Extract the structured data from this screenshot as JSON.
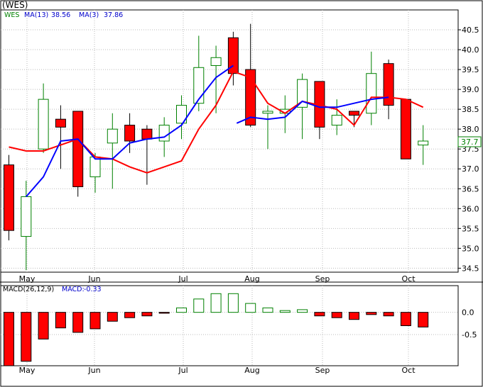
{
  "chart_data": [
    {
      "type": "candlestick",
      "title": "(WES)",
      "legend": [
        {
          "label": "WES",
          "color": "#008000"
        },
        {
          "label": "MA(13)",
          "value_text": "38.56",
          "color": "#0000cc"
        },
        {
          "label": "MA(3)",
          "value_text": "37.86",
          "color": "#0000cc"
        }
      ],
      "last_price_label": "37.7",
      "ylim": [
        34.4,
        41.0
      ],
      "y_ticks": [
        "34.5",
        "35.0",
        "35.5",
        "36.0",
        "36.5",
        "37.0",
        "37.5",
        "38.0",
        "38.5",
        "39.0",
        "39.5",
        "40.0",
        "40.5"
      ],
      "x_ticks": [
        "May",
        "Jun",
        "Jul",
        "Aug",
        "Sep",
        "Oct"
      ],
      "grid": true,
      "colors": {
        "up": "#008000",
        "down": "#ff0000",
        "ma13": "#0000ff",
        "ma3": "#ff0000",
        "up_fill": "#ffffff",
        "down_fill": "#ff0000"
      },
      "candles": [
        {
          "o": 37.1,
          "h": 37.35,
          "l": 35.2,
          "c": 35.45
        },
        {
          "o": 35.3,
          "h": 36.7,
          "l": 34.45,
          "c": 36.3
        },
        {
          "o": 37.5,
          "h": 39.15,
          "l": 37.4,
          "c": 38.75
        },
        {
          "o": 38.25,
          "h": 38.6,
          "l": 37.0,
          "c": 38.05
        },
        {
          "o": 38.45,
          "h": 38.45,
          "l": 36.3,
          "c": 36.55
        },
        {
          "o": 36.8,
          "h": 37.4,
          "l": 36.4,
          "c": 37.3
        },
        {
          "o": 37.65,
          "h": 38.4,
          "l": 36.5,
          "c": 38.0
        },
        {
          "o": 38.1,
          "h": 38.4,
          "l": 37.4,
          "c": 37.7
        },
        {
          "o": 38.0,
          "h": 38.1,
          "l": 36.6,
          "c": 37.75
        },
        {
          "o": 37.7,
          "h": 38.3,
          "l": 37.3,
          "c": 38.1
        },
        {
          "o": 38.15,
          "h": 38.85,
          "l": 37.75,
          "c": 38.6
        },
        {
          "o": 38.65,
          "h": 40.35,
          "l": 38.45,
          "c": 39.55
        },
        {
          "o": 39.6,
          "h": 40.1,
          "l": 38.4,
          "c": 39.8
        },
        {
          "o": 40.3,
          "h": 40.45,
          "l": 39.1,
          "c": 39.4
        },
        {
          "o": 39.5,
          "h": 40.65,
          "l": 38.05,
          "c": 38.1
        },
        {
          "o": 38.4,
          "h": 38.6,
          "l": 37.5,
          "c": 38.45
        },
        {
          "o": 38.4,
          "h": 38.85,
          "l": 37.9,
          "c": 38.5
        },
        {
          "o": 38.55,
          "h": 39.4,
          "l": 37.75,
          "c": 39.25
        },
        {
          "o": 39.2,
          "h": 39.2,
          "l": 37.75,
          "c": 38.05
        },
        {
          "o": 38.1,
          "h": 38.75,
          "l": 37.85,
          "c": 38.35
        },
        {
          "o": 38.45,
          "h": 38.45,
          "l": 38.05,
          "c": 38.35
        },
        {
          "o": 38.4,
          "h": 39.95,
          "l": 38.1,
          "c": 39.4
        },
        {
          "o": 39.65,
          "h": 39.75,
          "l": 38.25,
          "c": 38.6
        },
        {
          "o": 38.75,
          "h": 38.75,
          "l": 37.25,
          "c": 37.25
        },
        {
          "o": 37.6,
          "h": 38.1,
          "l": 37.1,
          "c": 37.7
        }
      ],
      "ma13": [
        {
          "i": 1,
          "v": 36.3
        },
        {
          "i": 2,
          "v": 36.8
        },
        {
          "i": 3,
          "v": 37.7
        },
        {
          "i": 4,
          "v": 37.75
        },
        {
          "i": 5,
          "v": 37.25
        },
        {
          "i": 6,
          "v": 37.25
        },
        {
          "i": 7,
          "v": 37.65
        },
        {
          "i": 8,
          "v": 37.75
        },
        {
          "i": 9,
          "v": 37.8
        },
        {
          "i": 10,
          "v": 38.1
        },
        {
          "i": 11,
          "v": 38.75
        },
        {
          "i": 12,
          "v": 39.3
        },
        {
          "i": 13,
          "v": 39.6
        }
      ],
      "ma13_tail": [
        {
          "i": 13.2,
          "v": 38.15
        },
        {
          "i": 14,
          "v": 38.3
        },
        {
          "i": 15,
          "v": 38.25
        },
        {
          "i": 16,
          "v": 38.3
        },
        {
          "i": 17,
          "v": 38.7
        },
        {
          "i": 18,
          "v": 38.55
        },
        {
          "i": 19,
          "v": 38.55
        },
        {
          "i": 20,
          "v": 38.65
        },
        {
          "i": 21,
          "v": 38.75
        },
        {
          "i": 22,
          "v": 38.8
        }
      ],
      "ma3": [
        {
          "i": 0,
          "v": 37.55
        },
        {
          "i": 1,
          "v": 37.45
        },
        {
          "i": 2,
          "v": 37.45
        },
        {
          "i": 3,
          "v": 37.6
        },
        {
          "i": 4,
          "v": 37.75
        },
        {
          "i": 5,
          "v": 37.3
        },
        {
          "i": 6,
          "v": 37.25
        },
        {
          "i": 7,
          "v": 37.05
        },
        {
          "i": 8,
          "v": 36.9
        },
        {
          "i": 9,
          "v": 37.05
        },
        {
          "i": 10,
          "v": 37.2
        },
        {
          "i": 11,
          "v": 38.0
        },
        {
          "i": 12,
          "v": 38.6
        },
        {
          "i": 13,
          "v": 39.45
        },
        {
          "i": 14,
          "v": 39.3
        },
        {
          "i": 15,
          "v": 38.65
        },
        {
          "i": 16,
          "v": 38.4
        },
        {
          "i": 17,
          "v": 38.7
        },
        {
          "i": 18,
          "v": 38.6
        },
        {
          "i": 19,
          "v": 38.5
        },
        {
          "i": 20,
          "v": 38.1
        },
        {
          "i": 21,
          "v": 38.8
        },
        {
          "i": 22,
          "v": 38.8
        },
        {
          "i": 23,
          "v": 38.75
        },
        {
          "i": 24,
          "v": 38.55
        }
      ]
    },
    {
      "type": "bar",
      "title": "MACD(26,12,9)",
      "legend": [
        {
          "label": "MACD(26,12,9)",
          "color": "#000000"
        },
        {
          "label": "MACD:",
          "value_text": "-0.33",
          "color": "#0000cc"
        }
      ],
      "ylim": [
        -1.2,
        0.6
      ],
      "y_ticks": [
        "0.0",
        "-0.5"
      ],
      "x_ticks": [
        "May",
        "Jun",
        "Jul",
        "Aug",
        "Sep",
        "Oct"
      ],
      "values": [
        -1.2,
        -1.1,
        -0.6,
        -0.35,
        -0.45,
        -0.37,
        -0.2,
        -0.12,
        -0.08,
        -0.02,
        0.1,
        0.3,
        0.42,
        0.42,
        0.2,
        0.1,
        0.04,
        0.06,
        -0.08,
        -0.12,
        -0.16,
        -0.05,
        -0.08,
        -0.3,
        -0.33
      ],
      "colors": {
        "positive": "#008000",
        "negative": "#ff0000"
      }
    }
  ]
}
